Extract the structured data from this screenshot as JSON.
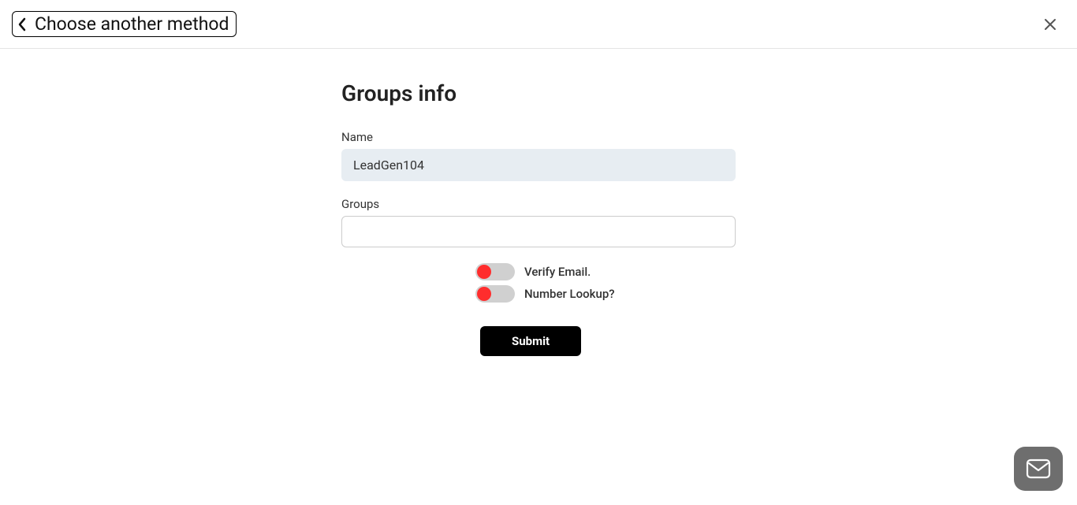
{
  "header": {
    "back_label": "Choose another method"
  },
  "form": {
    "title": "Groups info",
    "name_label": "Name",
    "name_value": "LeadGen104",
    "groups_label": "Groups",
    "groups_value": "",
    "toggles": {
      "verify_email": "Verify Email.",
      "number_lookup": "Number Lookup?"
    },
    "submit_label": "Submit"
  }
}
